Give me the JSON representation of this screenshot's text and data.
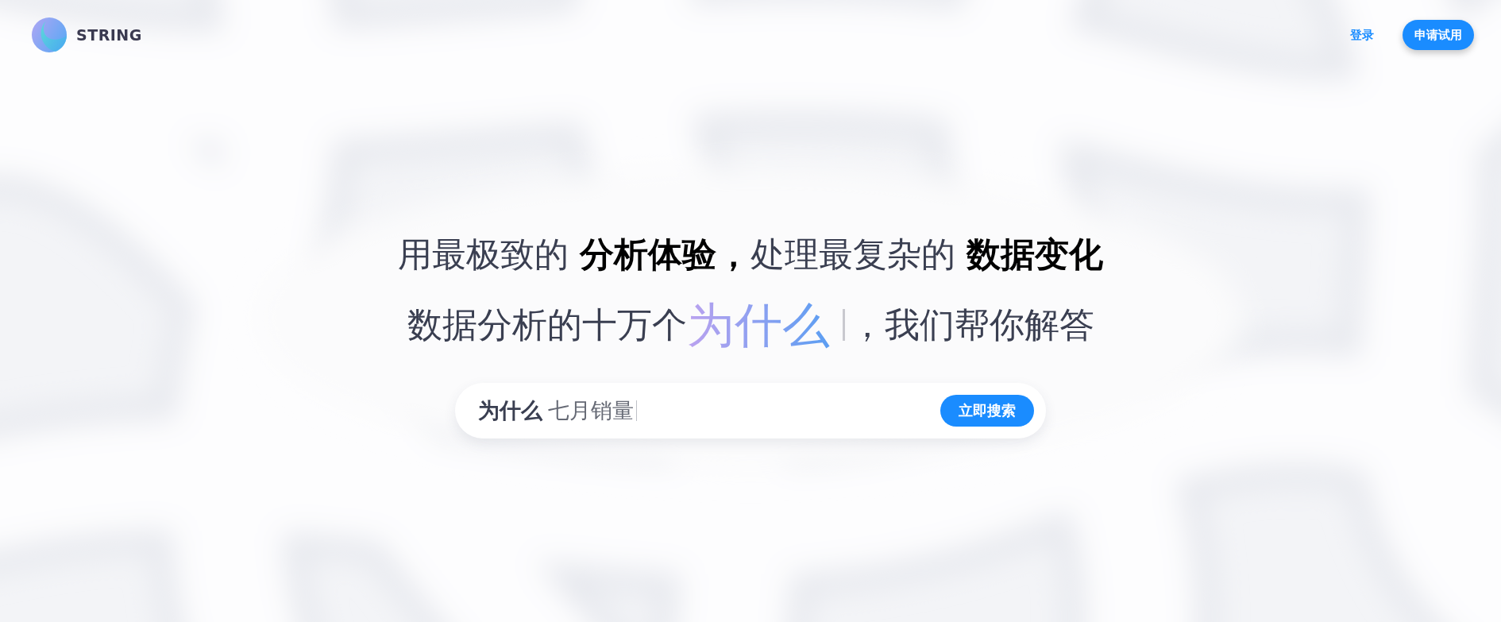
{
  "header": {
    "logo": {
      "text": "STRING"
    },
    "nav": [
      {
        "kind": "link",
        "label": "登录"
      },
      {
        "kind": "button",
        "label": "申请试用"
      }
    ]
  },
  "hero": {
    "headline": "用最极致的 **分析体验，**处理最复杂的 **数据变化**",
    "tagline": {
      "prefix": "数据分析的十万个",
      "highlight": "为什么",
      "cursor": true,
      "suffix": "，我们帮你解答"
    }
  },
  "search": {
    "prefix": "为什么",
    "value": "七月销量",
    "cursor": true,
    "button": "立即搜索"
  }
}
